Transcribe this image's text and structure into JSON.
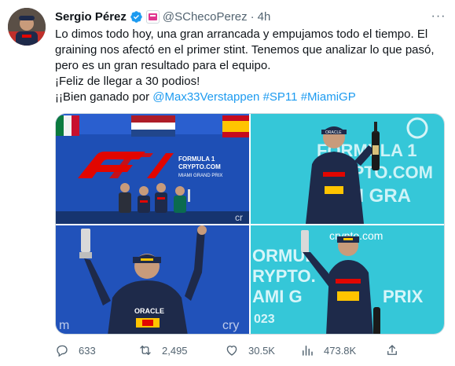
{
  "tweet": {
    "author_name": "Sergio Pérez",
    "handle": "@SChecoPerez",
    "separator": "·",
    "time": "4h",
    "more_label": "···",
    "lines": {
      "l1": "Lo dimos todo hoy, una gran arrancada y empujamos todo el tiempo. El graining nos afectó en el primer stint. Tenemos que analizar lo que pasó, pero es un gran resultado para el equipo.",
      "l2": "¡Feliz de llegar a 30 podios!",
      "l3_prefix": "¡¡Bien ganado por ",
      "mention": "@Max33Verstappen",
      "hashtag1": "#SP11",
      "hashtag2": "#MiamiGP"
    },
    "verified_color": "#1d9bf0"
  },
  "media": {
    "image1": {
      "banner_text": "F1",
      "sponsor_line1": "FORMULA 1",
      "sponsor_line2": "CRYPTO.COM",
      "sponsor_line3": "MIAMI GRAND PRIX",
      "corner_text": "cr"
    },
    "image2": {
      "bg_text_1": "FORMULA 1",
      "bg_text_2": "CRYPTO.COM",
      "bg_text_3": "AMI GRA",
      "cap_text": "ORACLE"
    },
    "image3": {
      "corner_left": "m",
      "corner_right": "cry",
      "suit_text": "ORACLE"
    },
    "image4": {
      "top_text": "crypto.com",
      "bg_text_1": "ORMUL",
      "bg_text_2": "RYPTO.",
      "bg_text_3": "AMI G",
      "bg_text_4": "PRIX",
      "year": "023"
    }
  },
  "actions": {
    "reply_count": "633",
    "retweet_count": "2,495",
    "like_count": "30.5K",
    "views_count": "473.8K"
  },
  "colors": {
    "text": "#0f1419",
    "muted": "#536471",
    "link": "#1d9bf0",
    "redbull_navy": "#1e2a4a",
    "f1_red": "#e10600",
    "backdrop_blue": "#1e4fb5",
    "miami_teal": "#35c7d8"
  }
}
